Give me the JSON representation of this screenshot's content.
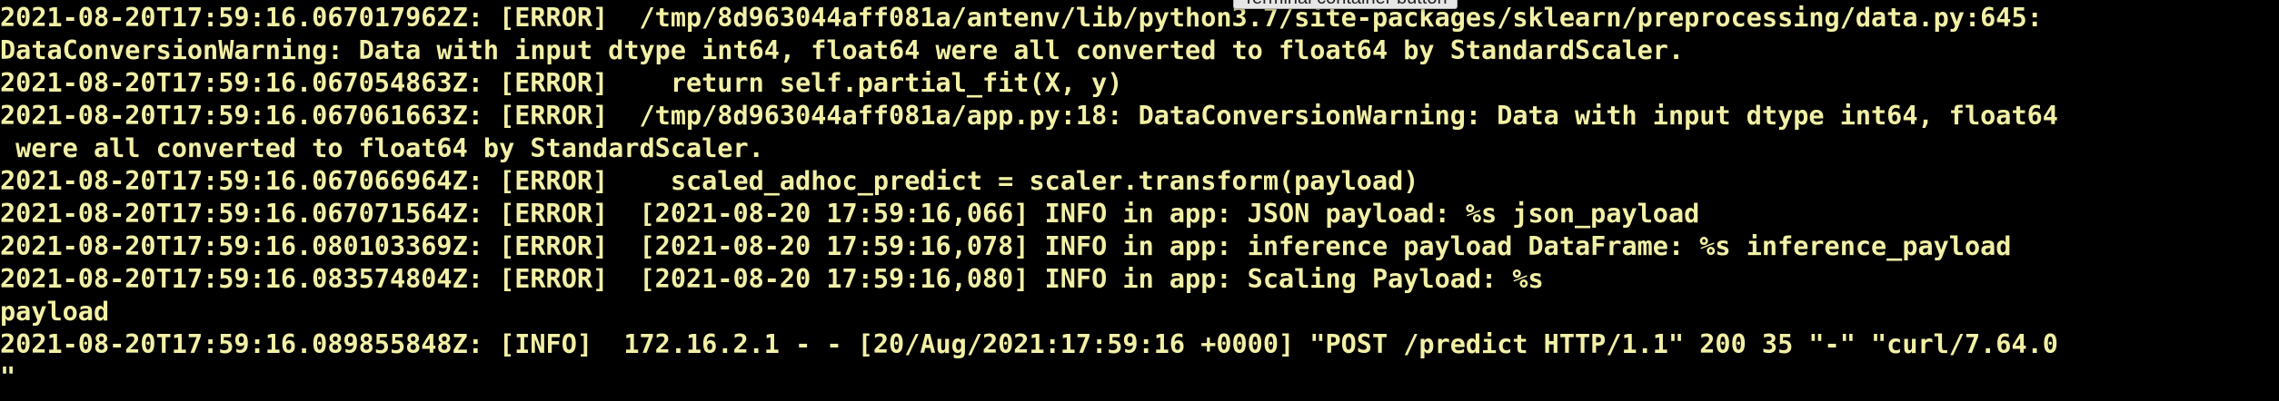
{
  "colors": {
    "background": "#000000",
    "text": "#f2f0a5",
    "tooltip_bg": "#e6e6e6"
  },
  "tooltip": {
    "label": "Terminal container button"
  },
  "terminal": {
    "lines": [
      "2021-08-20T17:59:16.067017962Z: [ERROR]  /tmp/8d963044aff081a/antenv/lib/python3.7/site-packages/sklearn/preprocessing/data.py:645:",
      "DataConversionWarning: Data with input dtype int64, float64 were all converted to float64 by StandardScaler.",
      "2021-08-20T17:59:16.067054863Z: [ERROR]    return self.partial_fit(X, y)",
      "2021-08-20T17:59:16.067061663Z: [ERROR]  /tmp/8d963044aff081a/app.py:18: DataConversionWarning: Data with input dtype int64, float64",
      " were all converted to float64 by StandardScaler.",
      "2021-08-20T17:59:16.067066964Z: [ERROR]    scaled_adhoc_predict = scaler.transform(payload)",
      "2021-08-20T17:59:16.067071564Z: [ERROR]  [2021-08-20 17:59:16,066] INFO in app: JSON payload: %s json_payload",
      "2021-08-20T17:59:16.080103369Z: [ERROR]  [2021-08-20 17:59:16,078] INFO in app: inference payload DataFrame: %s inference_payload",
      "2021-08-20T17:59:16.083574804Z: [ERROR]  [2021-08-20 17:59:16,080] INFO in app: Scaling Payload: %s",
      "payload",
      "2021-08-20T17:59:16.089855848Z: [INFO]  172.16.2.1 - - [20/Aug/2021:17:59:16 +0000] \"POST /predict HTTP/1.1\" 200 35 \"-\" \"curl/7.64.0",
      "\""
    ]
  }
}
